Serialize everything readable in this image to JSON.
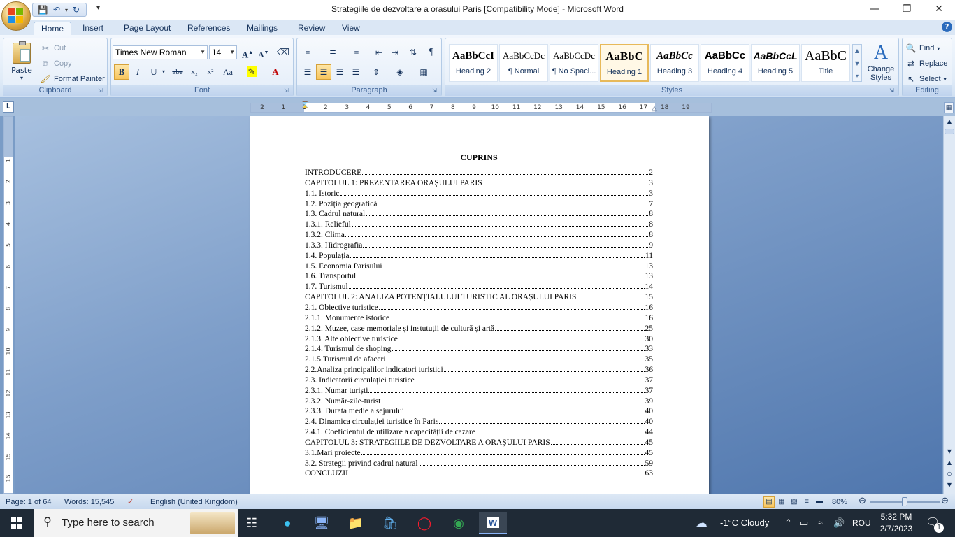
{
  "window": {
    "title": "Strategiile de dezvoltare a orasului Paris [Compatibility Mode] - Microsoft Word",
    "minimize_icon": "minimize-icon",
    "restore_icon": "restore-icon",
    "close_icon": "close-icon"
  },
  "tabs": [
    "Home",
    "Insert",
    "Page Layout",
    "References",
    "Mailings",
    "Review",
    "View"
  ],
  "active_tab": "Home",
  "ribbon": {
    "clipboard": {
      "label": "Clipboard",
      "paste": "Paste",
      "cut": "Cut",
      "copy": "Copy",
      "format_painter": "Format Painter"
    },
    "font": {
      "label": "Font",
      "font_name": "Times New Roman",
      "font_size": "14",
      "bold": "B",
      "italic": "I",
      "underline": "U",
      "strikethrough": "abe",
      "subscript": "x₂",
      "superscript": "x²",
      "change_case": "Aa",
      "grow": "A",
      "shrink": "A"
    },
    "paragraph": {
      "label": "Paragraph"
    },
    "styles": {
      "label": "Styles",
      "items": [
        {
          "sample": "AaBbCcI",
          "name": "Heading 2"
        },
        {
          "sample": "AaBbCcDc",
          "name": "¶ Normal"
        },
        {
          "sample": "AaBbCcDc",
          "name": "¶ No Spaci..."
        },
        {
          "sample": "AaBbC",
          "name": "Heading 1"
        },
        {
          "sample": "AaBbCc",
          "name": "Heading 3"
        },
        {
          "sample": "AaBbCc",
          "name": "Heading 4"
        },
        {
          "sample": "AaBbCcL",
          "name": "Heading 5"
        },
        {
          "sample": "AaBbC",
          "name": "Title"
        }
      ],
      "selected": "Heading 1",
      "change_styles": "Change Styles"
    },
    "editing": {
      "label": "Editing",
      "find": "Find",
      "replace": "Replace",
      "select": "Select"
    }
  },
  "ruler": {
    "ticks": [
      "2",
      "1",
      "1",
      "2",
      "3",
      "4",
      "5",
      "6",
      "7",
      "8",
      "9",
      "10",
      "11",
      "12",
      "13",
      "14",
      "15",
      "16",
      "17",
      "18",
      "19"
    ]
  },
  "document": {
    "toc_title": "CUPRINS",
    "toc": [
      {
        "text": "INTRODUCERE",
        "page": "2"
      },
      {
        "text": "CAPITOLUL 1: PREZENTAREA ORAȘULUI PARIS",
        "page": "3"
      },
      {
        "text": "1.1. Istoric",
        "page": "3"
      },
      {
        "text": "1.2. Poziția geografică",
        "page": "7"
      },
      {
        "text": "1.3. Cadrul natural",
        "page": "8"
      },
      {
        "text": "1.3.1. Relieful",
        "page": "8"
      },
      {
        "text": "1.3.2. Clima",
        "page": "8"
      },
      {
        "text": "1.3.3. Hidrografia",
        "page": "9"
      },
      {
        "text": "1.4. Populația",
        "page": "11"
      },
      {
        "text": "1.5. Economia Parisului",
        "page": "13"
      },
      {
        "text": "1.6. Transportul",
        "page": "13"
      },
      {
        "text": "1.7. Turismul",
        "page": "14"
      },
      {
        "text": "CAPITOLUL 2: ANALIZA POTENȚIALULUI TURISTIC AL ORAȘULUI PARIS",
        "page": "15"
      },
      {
        "text": "2.1. Obiective turistice",
        "page": "16"
      },
      {
        "text": "2.1.1. Monumente istorice",
        "page": "16"
      },
      {
        "text": "2.1.2. Muzee, case memoriale și instutuții de cultură și artă",
        "page": "25"
      },
      {
        "text": "2.1.3. Alte obiective turistice",
        "page": "30"
      },
      {
        "text": "2.1.4. Turismul de shoping",
        "page": "33"
      },
      {
        "text": "2.1.5.Turismul de afaceri",
        "page": "35"
      },
      {
        "text": "2.2.Analiza principalilor indicatori turistici",
        "page": "36"
      },
      {
        "text": "2.3. Indicatorii circulației turistice",
        "page": "37"
      },
      {
        "text": "2.3.1. Numar turiști",
        "page": "37"
      },
      {
        "text": "2.3.2. Număr-zile-turist",
        "page": "39"
      },
      {
        "text": "2.3.3. Durata medie a sejurului",
        "page": "40"
      },
      {
        "text": "2.4. Dinamica circulației turistice în Paris",
        "page": "40"
      },
      {
        "text": "2.4.1. Coeficientul de utilizare a capacității de cazare",
        "page": "44"
      },
      {
        "text": "CAPITOLUL 3: STRATEGIILE DE DEZVOLTARE A ORAȘULUI PARIS",
        "page": "45"
      },
      {
        "text": "3.1.Mari proiecte",
        "page": "45"
      },
      {
        "text": "3.2. Strategii privind cadrul natural",
        "page": "59"
      },
      {
        "text": "CONCLUZII",
        "page": "63"
      }
    ]
  },
  "status": {
    "page": "Page: 1 of 64",
    "words": "Words: 15,545",
    "language": "English (United Kingdom)",
    "zoom": "80%",
    "zoom_level": 0.5
  },
  "taskbar": {
    "search_placeholder": "Type here to search",
    "weather": "-1°C  Cloudy",
    "language": "ROU",
    "time": "5:32 PM",
    "date": "2/7/2023",
    "notification_count": "1"
  }
}
